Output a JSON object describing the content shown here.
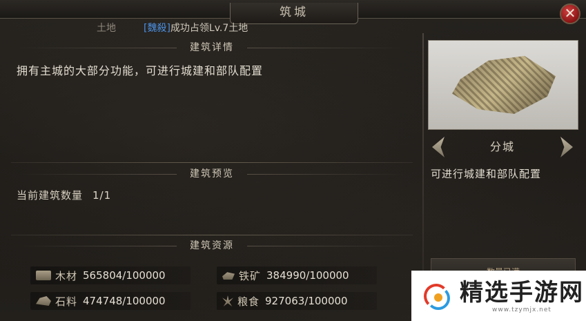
{
  "window": {
    "title": "筑城"
  },
  "land": {
    "label": "土地",
    "tag": "[魏殺]",
    "message": "成功占领Lv.7土地"
  },
  "sections": {
    "details": {
      "title": "建筑详情",
      "description": "拥有主城的大部分功能，可进行城建和部队配置"
    },
    "preview": {
      "title": "建筑预览",
      "count_label": "当前建筑数量",
      "count_value": "1/1"
    },
    "resources": {
      "title": "建筑资源"
    }
  },
  "resources": [
    {
      "icon": "wood-icon",
      "name": "木材",
      "value": "565804/100000"
    },
    {
      "icon": "ore-icon",
      "name": "铁矿",
      "value": "384990/100000"
    },
    {
      "icon": "stone-icon",
      "name": "石料",
      "value": "474748/100000"
    },
    {
      "icon": "grain-icon",
      "name": "粮食",
      "value": "927063/100000"
    }
  ],
  "building": {
    "name": "分城",
    "description": "可进行城建和部队配置",
    "status_button": "数量已满"
  },
  "watermark": {
    "title": "精选手游网",
    "url": "www.tzymjx.net"
  },
  "colors": {
    "tag": "#4a8fe0",
    "close": "#b81e1e"
  }
}
